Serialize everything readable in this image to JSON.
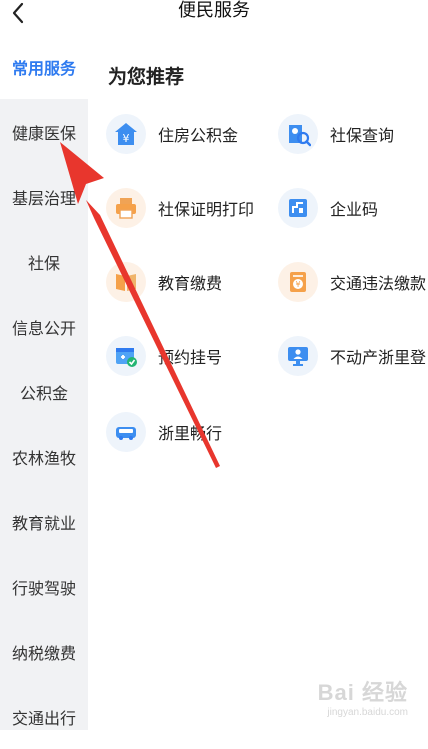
{
  "header": {
    "title": "便民服务"
  },
  "sidebar": {
    "items": [
      {
        "label": "常用服务"
      },
      {
        "label": "健康医保"
      },
      {
        "label": "基层治理"
      },
      {
        "label": "社保"
      },
      {
        "label": "信息公开"
      },
      {
        "label": "公积金"
      },
      {
        "label": "农林渔牧"
      },
      {
        "label": "教育就业"
      },
      {
        "label": "行驶驾驶"
      },
      {
        "label": "纳税缴费"
      },
      {
        "label": "交通出行"
      }
    ]
  },
  "main": {
    "section_title": "为您推荐",
    "services": [
      {
        "label": "住房公积金",
        "icon": "housing-fund-icon"
      },
      {
        "label": "社保查询",
        "icon": "social-security-query-icon"
      },
      {
        "label": "社保证明打印",
        "icon": "printer-icon"
      },
      {
        "label": "企业码",
        "icon": "enterprise-code-icon"
      },
      {
        "label": "教育缴费",
        "icon": "education-book-icon"
      },
      {
        "label": "交通违法缴款",
        "icon": "traffic-fine-icon"
      },
      {
        "label": "预约挂号",
        "icon": "calendar-appointment-icon"
      },
      {
        "label": "不动产浙里登",
        "icon": "monitor-person-icon"
      },
      {
        "label": "浙里畅行",
        "icon": "bus-icon"
      }
    ]
  },
  "watermark": {
    "line1": "Bai 经验",
    "line2": "jingyan.baidu.com"
  },
  "colors": {
    "accent": "#2f7bf0",
    "sidebar_bg": "#f1f2f4",
    "annotation_arrow": "#e8362d"
  }
}
